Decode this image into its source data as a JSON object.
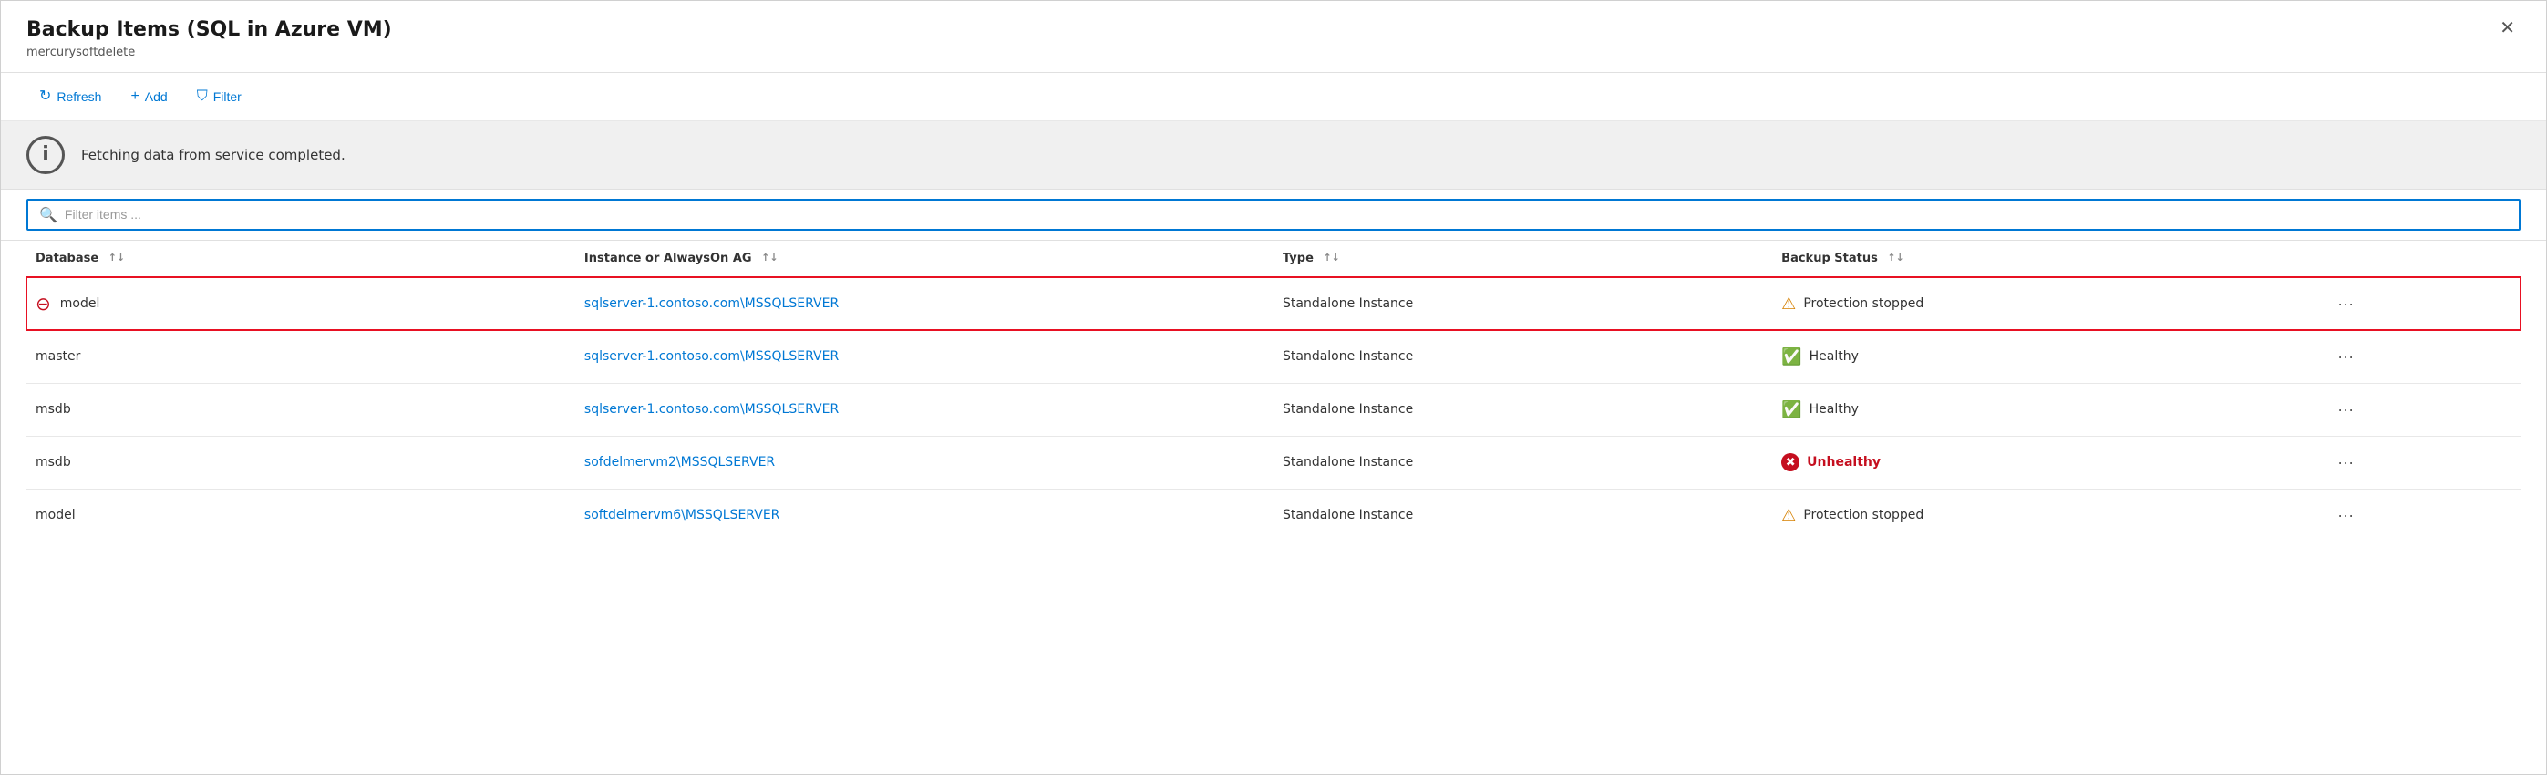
{
  "panel": {
    "title": "Backup Items (SQL in Azure VM)",
    "subtitle": "mercurysoftdelete",
    "close_label": "✕"
  },
  "toolbar": {
    "refresh_label": "Refresh",
    "add_label": "Add",
    "filter_label": "Filter"
  },
  "info_banner": {
    "message": "Fetching data from service completed."
  },
  "search": {
    "placeholder": "Filter items ..."
  },
  "table": {
    "columns": [
      {
        "key": "database",
        "label": "Database"
      },
      {
        "key": "instance",
        "label": "Instance or AlwaysOn AG"
      },
      {
        "key": "type",
        "label": "Type"
      },
      {
        "key": "backup_status",
        "label": "Backup Status"
      }
    ],
    "rows": [
      {
        "id": "row-1",
        "selected": true,
        "has_stop_icon": true,
        "database": "model",
        "instance": "sqlserver-1.contoso.com\\MSSQLSERVER",
        "instance_link": true,
        "type": "Standalone Instance",
        "status_type": "warning",
        "status_text": "Protection stopped"
      },
      {
        "id": "row-2",
        "selected": false,
        "has_stop_icon": false,
        "database": "master",
        "instance": "sqlserver-1.contoso.com\\MSSQLSERVER",
        "instance_link": true,
        "type": "Standalone Instance",
        "status_type": "healthy",
        "status_text": "Healthy"
      },
      {
        "id": "row-3",
        "selected": false,
        "has_stop_icon": false,
        "database": "msdb",
        "instance": "sqlserver-1.contoso.com\\MSSQLSERVER",
        "instance_link": true,
        "type": "Standalone Instance",
        "status_type": "healthy",
        "status_text": "Healthy"
      },
      {
        "id": "row-4",
        "selected": false,
        "has_stop_icon": false,
        "database": "msdb",
        "instance": "sofdelmervm2\\MSSQLSERVER",
        "instance_link": true,
        "type": "Standalone Instance",
        "status_type": "unhealthy",
        "status_text": "Unhealthy"
      },
      {
        "id": "row-5",
        "selected": false,
        "has_stop_icon": false,
        "database": "model",
        "instance": "softdelmervm6\\MSSQLSERVER",
        "instance_link": true,
        "type": "Standalone Instance",
        "status_type": "warning",
        "status_text": "Protection stopped"
      }
    ]
  }
}
